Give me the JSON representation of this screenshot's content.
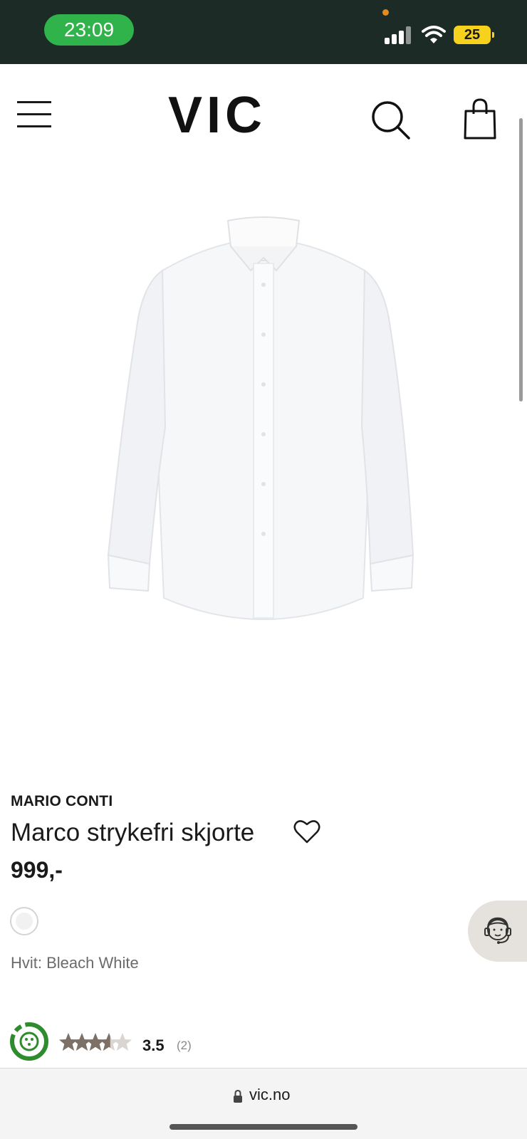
{
  "status_bar": {
    "time": "23:09",
    "battery": "25"
  },
  "header": {
    "logo_text": "VIC",
    "icons": [
      "menu-icon",
      "search-icon",
      "bag-icon"
    ]
  },
  "product": {
    "brand": "MARIO CONTI",
    "title": "Marco strykefri skjorte",
    "price": "999,-",
    "color_label": "Hvit: Bleach White",
    "rating": "3.5",
    "rating_count": "(2)",
    "rating_fraction": 0.7
  },
  "browser": {
    "url": "vic.no"
  },
  "colors": {
    "status_bg": "#1c2b25",
    "time_pill": "#2fb34a",
    "battery": "#f7d21c",
    "eco_green": "#2e8b2e",
    "star_filled": "#7d7066",
    "star_empty": "#d9d6d2"
  }
}
